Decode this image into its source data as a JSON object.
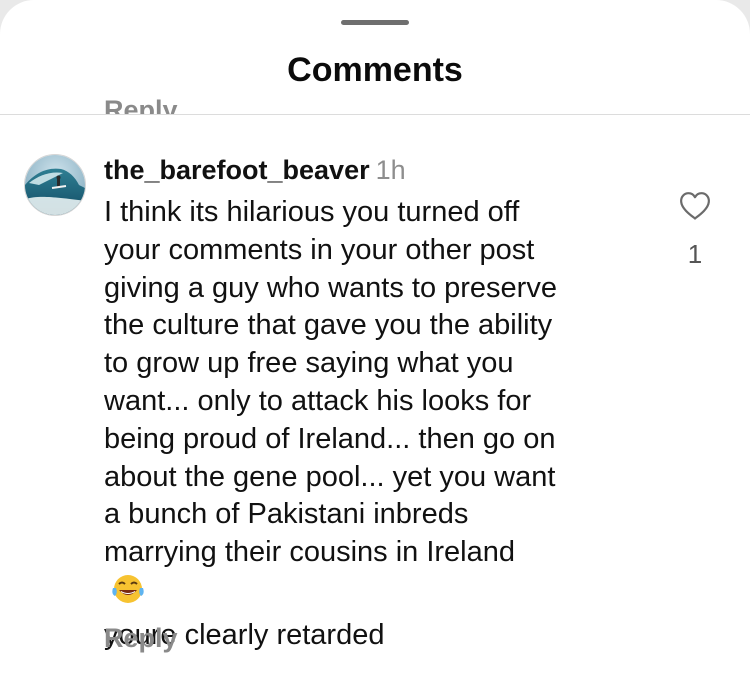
{
  "sheet": {
    "title": "Comments"
  },
  "previous_comment": {
    "reply_label": "Reply"
  },
  "comment": {
    "username": "the_barefoot_beaver",
    "time_ago": "1h",
    "lines": [
      "I think its hilarious you turned off",
      "your comments in your other post",
      "giving a guy who wants to preserve",
      "the culture that gave you the ability",
      "to grow up free saying what you",
      "want... only to attack his looks for",
      "being proud of Ireland... then go on",
      "about the gene pool... yet you want",
      "a bunch of Pakistani inbreds",
      "marrying their cousins in Ireland",
      "youre clearly retarded"
    ],
    "emoji": "face-with-tears-of-joy-emoji",
    "like_count": "1",
    "reply_label": "Reply",
    "icons": {
      "like": "heart-outline-icon",
      "avatar": "surfer-wave-avatar"
    }
  }
}
